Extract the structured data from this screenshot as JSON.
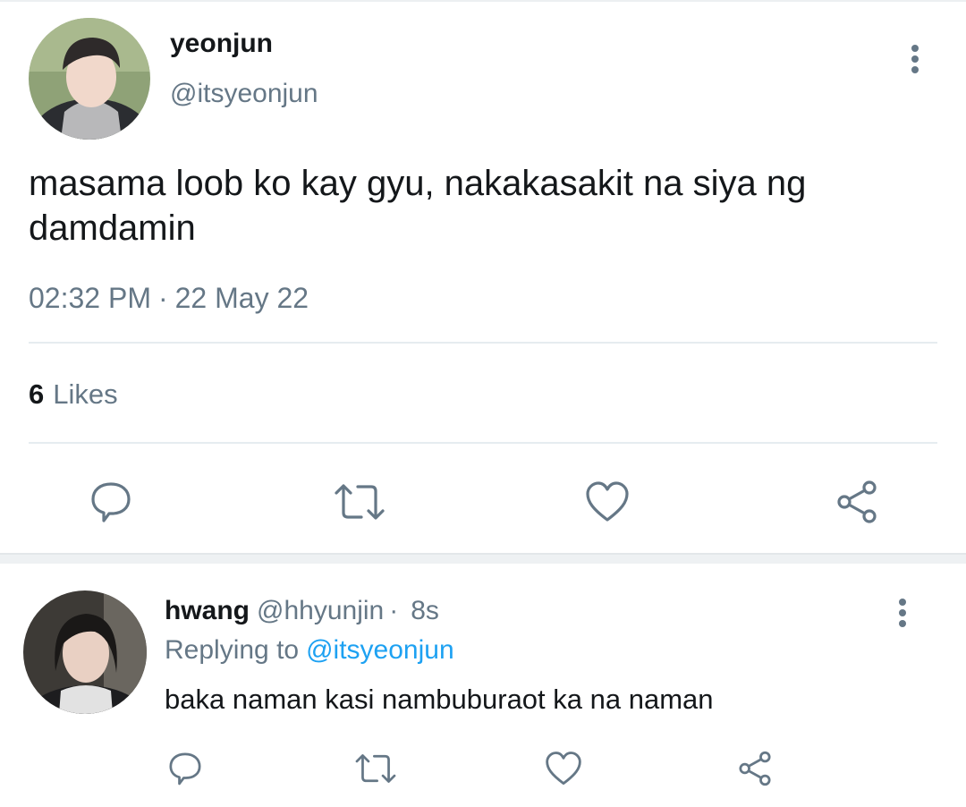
{
  "main_tweet": {
    "author_name": "yeonjun",
    "author_handle": "@itsyeonjun",
    "text": "masama loob ko kay gyu, nakakasakit na siya ng damdamin",
    "time": "02:32 PM",
    "separator": "·",
    "date": "22 May 22",
    "likes_count": "6",
    "likes_label": "Likes"
  },
  "reply": {
    "author_name": "hwang",
    "author_handle": "@hhyunjin",
    "separator": "·",
    "age": "8s",
    "replying_to_label": "Replying to",
    "replying_to_handle": "@itsyeonjun",
    "text": "baka naman kasi nambuburaot ka na naman"
  },
  "icons": {
    "reply": "speech-bubble-icon",
    "retweet": "retweet-icon",
    "like": "heart-icon",
    "share": "share-icon",
    "more": "vertical-dots-icon"
  },
  "colors": {
    "text": "#14171a",
    "secondary": "#657786",
    "link": "#1da1f2",
    "divider": "#e6ecf0"
  }
}
